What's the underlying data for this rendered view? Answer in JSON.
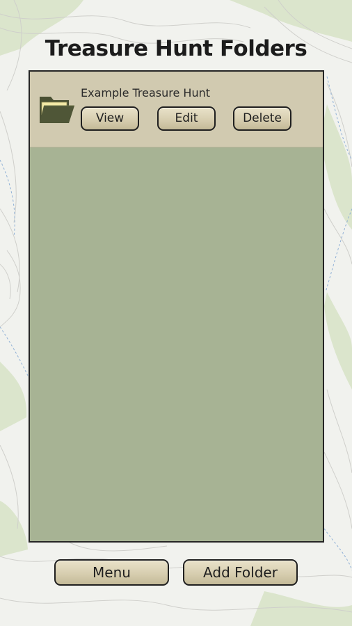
{
  "title": "Treasure Hunt Folders",
  "folders": [
    {
      "name": "Example Treasure Hunt",
      "icon": "open-folder-icon",
      "actions": {
        "view": "View",
        "edit": "Edit",
        "delete": "Delete"
      }
    }
  ],
  "footer": {
    "menu_label": "Menu",
    "add_folder_label": "Add Folder"
  },
  "colors": {
    "list_background": "#a7b394",
    "row_background": "#d1cab0",
    "button_fill": "#d7ceb0",
    "folder_icon": "#4a5033",
    "folder_paper": "#f2e9a6"
  }
}
